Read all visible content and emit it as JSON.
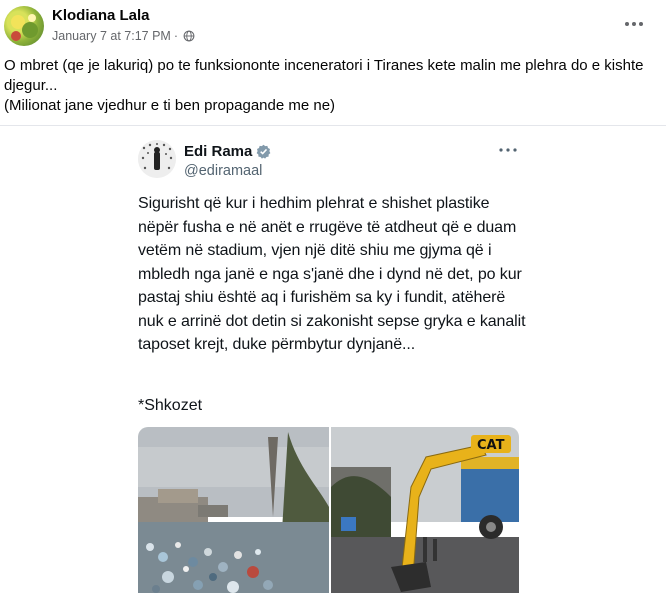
{
  "post": {
    "author": "Klodiana Lala",
    "date": "January 7 at 7:17 PM",
    "separator": "·",
    "text_lines": [
      "O mbret (qe je lakuriq)  po te funksiononte inceneratori i Tiranes kete malin me plehra do e kishte djegur...",
      "(Milionat jane vjedhur e ti ben propagande me ne)"
    ]
  },
  "tweet": {
    "name": "Edi Rama",
    "handle": "@ediramaal",
    "body": "Sigurisht që kur i hedhim plehrat e shishet plastike nëpër fusha e në anët e rrugëve të atdheut që e duam vetëm në stadium, vjen një ditë shiu me gjyma që i mbledh nga janë e nga s'janë dhe i dynd në det, po kur pastaj shiu është aq i furishëm sa ky i fundit, atëherë nuk e arrinë dot detin si zakonisht sepse gryka e kanalit taposet krejt, duke përmbytur dynjanë...",
    "footnote": "*Shkozet",
    "excavator_brand": "CAT"
  },
  "colors": {
    "meta_gray": "#65676b",
    "twitter_blue": "#1d9bf0",
    "excavator_yellow": "#e8b21a"
  }
}
